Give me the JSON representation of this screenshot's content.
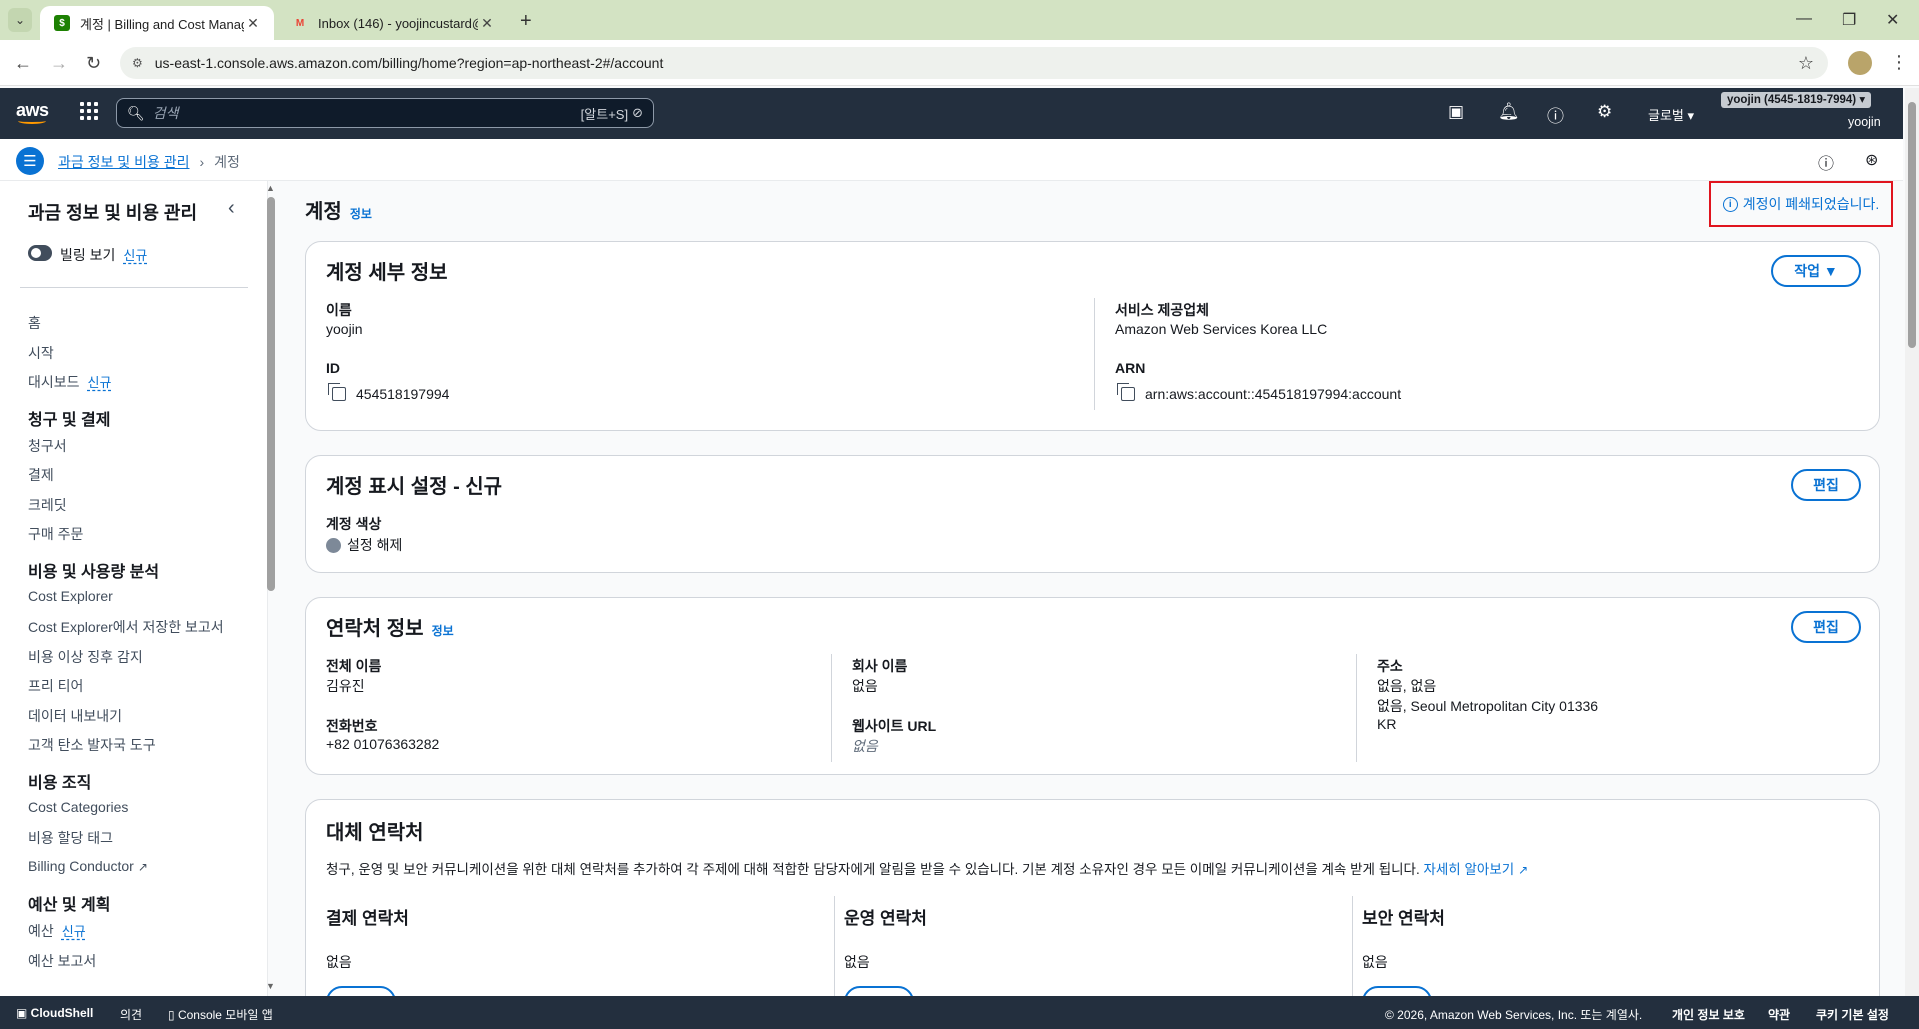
{
  "browser": {
    "tabs": [
      {
        "title": "계정 | Billing and Cost Manag",
        "active": true
      },
      {
        "title": "Inbox (146) - yoojincustard@g",
        "active": false
      }
    ],
    "url": "us-east-1.console.aws.amazon.com/billing/home?region=ap-northeast-2#/account"
  },
  "aws_nav": {
    "search_placeholder": "검색",
    "search_shortcut": "[알트+S]",
    "region": "글로벌",
    "account_badge": "yoojin (4545-1819-7994) ▾",
    "user": "yoojin"
  },
  "breadcrumb": {
    "root": "과금 정보 및 비용 관리",
    "current": "계정"
  },
  "sidebar": {
    "title": "과금 정보 및 비용 관리",
    "toggle_label": "빌링 보기",
    "new_tag": "신규",
    "items": [
      {
        "kind": "item",
        "label": "홈"
      },
      {
        "kind": "item",
        "label": "시작"
      },
      {
        "kind": "item",
        "label": "대시보드",
        "tag": "신규"
      },
      {
        "kind": "section",
        "label": "청구 및 결제"
      },
      {
        "kind": "item",
        "label": "청구서"
      },
      {
        "kind": "item",
        "label": "결제"
      },
      {
        "kind": "item",
        "label": "크레딧"
      },
      {
        "kind": "item",
        "label": "구매 주문"
      },
      {
        "kind": "section",
        "label": "비용 및 사용량 분석"
      },
      {
        "kind": "item",
        "label": "Cost Explorer"
      },
      {
        "kind": "item",
        "label": "Cost Explorer에서 저장한 보고서"
      },
      {
        "kind": "item",
        "label": "비용 이상 징후 감지"
      },
      {
        "kind": "item",
        "label": "프리 티어"
      },
      {
        "kind": "item",
        "label": "데이터 내보내기"
      },
      {
        "kind": "item",
        "label": "고객 탄소 발자국 도구"
      },
      {
        "kind": "section",
        "label": "비용 조직"
      },
      {
        "kind": "item",
        "label": "Cost Categories"
      },
      {
        "kind": "item",
        "label": "비용 할당 태그"
      },
      {
        "kind": "item",
        "label": "Billing Conductor",
        "external": true
      },
      {
        "kind": "section",
        "label": "예산 및 계획"
      },
      {
        "kind": "item",
        "label": "예산",
        "tag": "신규"
      },
      {
        "kind": "item",
        "label": "예산 보고서"
      }
    ]
  },
  "page": {
    "title": "계정",
    "info": "정보",
    "closed_notice": "계정이 폐쇄되었습니다."
  },
  "account_details": {
    "heading": "계정 세부 정보",
    "action_button": "작업",
    "name_label": "이름",
    "name_value": "yoojin",
    "id_label": "ID",
    "id_value": "454518197994",
    "provider_label": "서비스 제공업체",
    "provider_value": "Amazon Web Services Korea LLC",
    "arn_label": "ARN",
    "arn_value": "arn:aws:account::454518197994:account"
  },
  "display_settings": {
    "heading": "계정 표시 설정 - 신규",
    "edit_button": "편집",
    "color_label": "계정 색상",
    "color_value": "설정 해제",
    "color_swatch": "#7d8998"
  },
  "contact": {
    "heading": "연락처 정보",
    "info": "정보",
    "edit_button": "편집",
    "fullname_label": "전체 이름",
    "fullname_value": "김유진",
    "phone_label": "전화번호",
    "phone_value": "+82 01076363282",
    "company_label": "회사 이름",
    "company_value": "없음",
    "website_label": "웹사이트 URL",
    "website_value": "없음",
    "address_label": "주소",
    "address_line1": "없음, 없음",
    "address_line2": "없음, Seoul Metropolitan City 01336",
    "address_line3": "KR"
  },
  "alternate": {
    "heading": "대체 연락처",
    "description": "청구, 운영 및 보안 커뮤니케이션을 위한 대체 연락처를 추가하여 각 주제에 대해 적합한 담당자에게 알림을 받을 수 있습니다. 기본 계정 소유자인 경우 모든 이메일 커뮤니케이션을 계속 받게 됩니다.",
    "learn_more": "자세히 알아보기",
    "billing_title": "결제 연락처",
    "billing_value": "없음",
    "ops_title": "운영 연락처",
    "ops_value": "없음",
    "security_title": "보안 연락처",
    "security_value": "없음"
  },
  "footer": {
    "cloudshell": "CloudShell",
    "feedback": "의견",
    "mobile": "Console 모바일 앱",
    "copyright": "© 2026, Amazon Web Services, Inc. 또는 계열사.",
    "privacy": "개인 정보 보호",
    "terms": "약관",
    "cookies": "쿠키 기본 설정"
  },
  "colors": {
    "accent": "#0972d3",
    "nav_bg": "#232f3e",
    "alert_border": "#e0141e"
  }
}
